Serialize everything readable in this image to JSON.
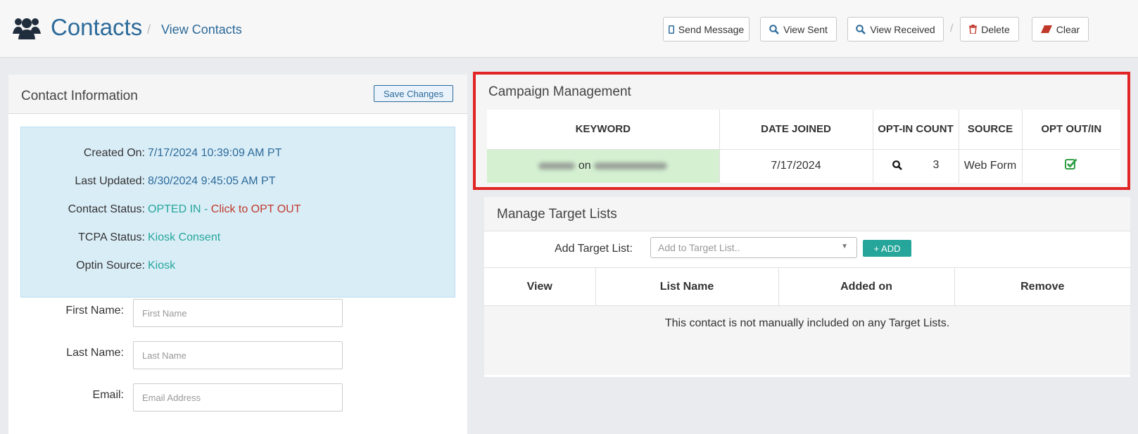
{
  "header": {
    "title": "Contacts",
    "separator": "/",
    "breadcrumb": "View Contacts",
    "buttons": {
      "send_message": "Send Message",
      "view_sent": "View Sent",
      "view_received": "View Received",
      "delete": "Delete",
      "clear": "Clear"
    },
    "divider": "/"
  },
  "contact_info": {
    "title": "Contact Information",
    "save_label": "Save Changes",
    "created_on_label": "Created On:",
    "created_on": "7/17/2024 10:39:09 AM PT",
    "last_updated_label": "Last Updated:",
    "last_updated": "8/30/2024 9:45:05 AM PT",
    "status_label": "Contact Status:",
    "status_value": "OPTED IN",
    "status_sep": " - ",
    "status_action": "Click to OPT OUT",
    "tcpa_label": "TCPA Status:",
    "tcpa_value": "Kiosk Consent",
    "optin_label": "Optin Source:",
    "optin_value": "Kiosk",
    "form": {
      "first_name_label": "First Name:",
      "first_name_placeholder": "First Name",
      "first_name_value": "",
      "last_name_label": "Last Name:",
      "last_name_placeholder": "Last Name",
      "last_name_value": "",
      "email_label": "Email:",
      "email_placeholder": "Email Address",
      "email_value": ""
    }
  },
  "campaign": {
    "title": "Campaign Management",
    "columns": [
      "KEYWORD",
      "DATE JOINED",
      "OPT-IN COUNT",
      "SOURCE",
      "OPT OUT/IN"
    ],
    "row": {
      "keyword_connector": "on",
      "date_joined": "7/17/2024",
      "optin_count": "3",
      "source": "Web Form",
      "opted_in": true
    }
  },
  "target_lists": {
    "title": "Manage Target Lists",
    "add_label": "Add Target List:",
    "select_placeholder": "Add to Target List..",
    "add_button": "+ ADD",
    "columns": [
      "View",
      "List Name",
      "Added on",
      "Remove"
    ],
    "empty_message": "This contact is not manually included on any Target Lists."
  },
  "colors": {
    "accent": "#2c6a9a",
    "success": "#26a69a",
    "danger": "#c0392b",
    "highlight_border": "#e12424"
  }
}
